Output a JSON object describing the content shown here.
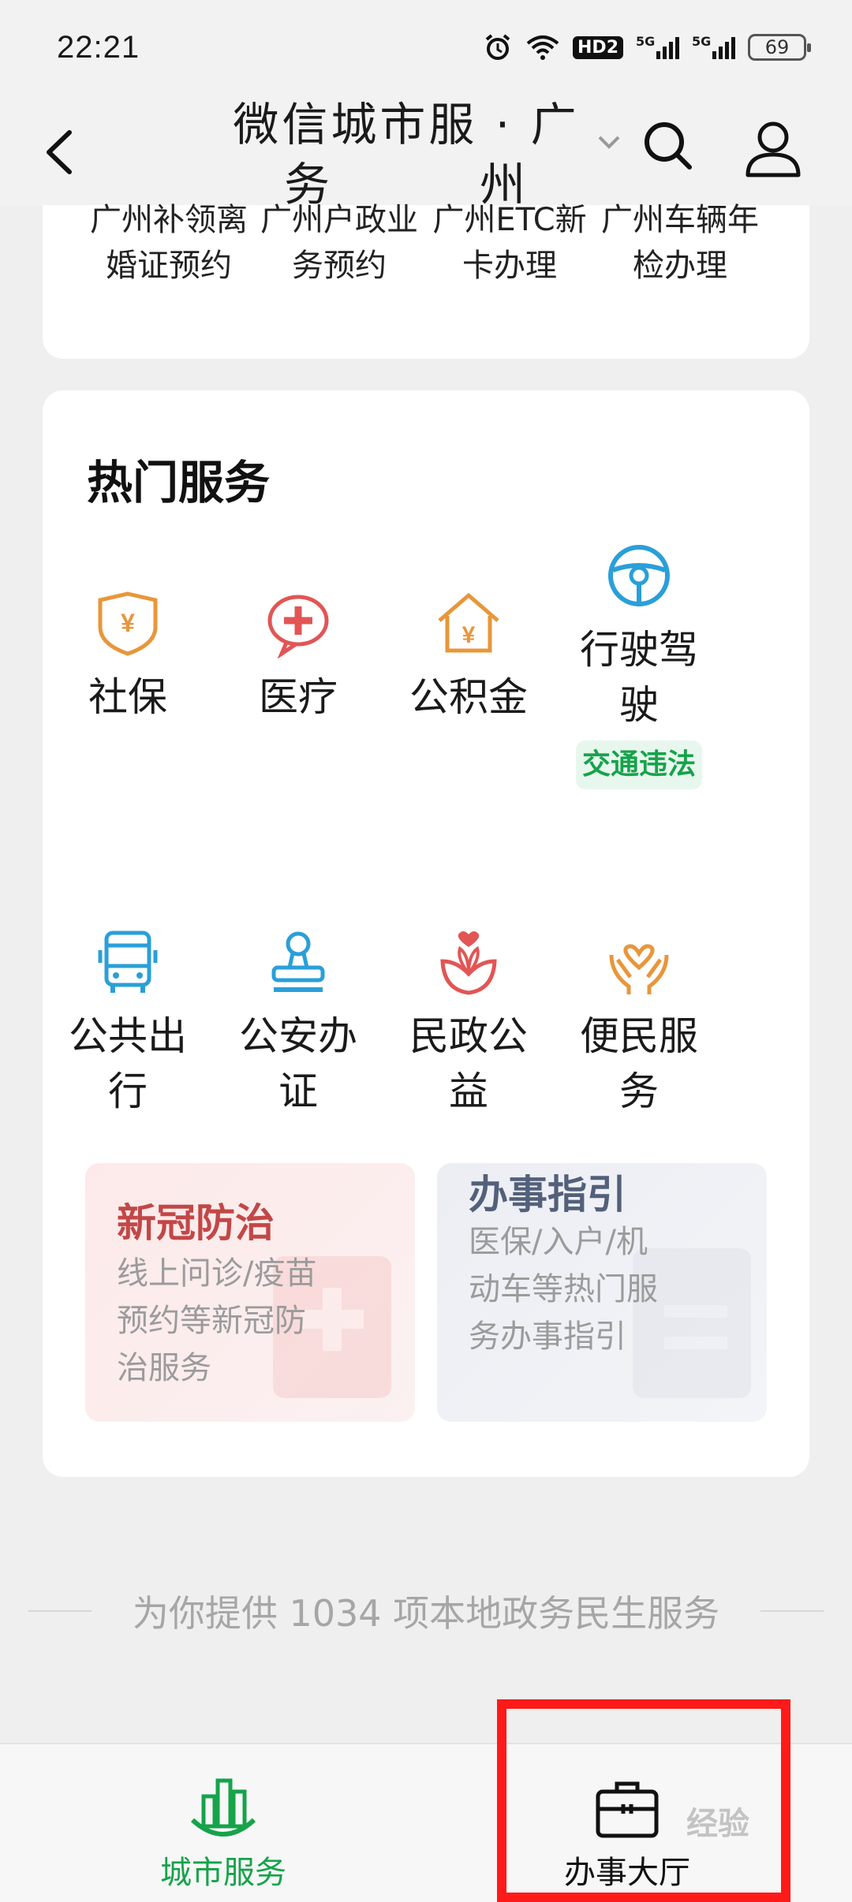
{
  "status_bar": {
    "time": "22:21",
    "hd_label": "HD2",
    "signal1_label": "5G",
    "signal2_label": "5G",
    "battery": "69",
    "icons": [
      "alarm-icon",
      "wifi-icon",
      "signal-icon",
      "battery-icon"
    ]
  },
  "header": {
    "title_line1": "微信城市服 · 广",
    "title_line2": "务　　　州",
    "icons": [
      "back-icon",
      "chevron-down-icon",
      "search-icon",
      "profile-icon"
    ]
  },
  "top_links": [
    {
      "line1": "广州补领离",
      "line2": "婚证预约"
    },
    {
      "line1": "广州户政业",
      "line2": "务预约"
    },
    {
      "line1": "广州ETC新",
      "line2": "卡办理"
    },
    {
      "line1": "广州车辆年",
      "line2": "检办理"
    }
  ],
  "hot_services": {
    "title": "热门服务",
    "items": [
      {
        "label": "社保",
        "icon": "social-insurance-icon",
        "color": "#e8963a"
      },
      {
        "label": "医疗",
        "icon": "medical-icon",
        "color": "#e25555"
      },
      {
        "label": "公积金",
        "icon": "housing-fund-icon",
        "color": "#e8963a"
      },
      {
        "label": "行驶驾驶",
        "icon": "steering-wheel-icon",
        "color": "#2a9fd8",
        "tag": "交通违法"
      },
      {
        "label": "公共出行",
        "icon": "bus-icon",
        "color": "#2a9fd8"
      },
      {
        "label": "公安办证",
        "icon": "stamp-icon",
        "color": "#2a9fd8"
      },
      {
        "label": "民政公益",
        "icon": "flower-heart-icon",
        "color": "#e25555"
      },
      {
        "label": "便民服务",
        "icon": "hands-heart-icon",
        "color": "#e8963a"
      }
    ]
  },
  "promos": {
    "covid": {
      "title": "新冠防治",
      "desc": "线上问诊/疫苗预约等新冠防治服务"
    },
    "guide": {
      "title": "办事指引",
      "desc": "医保/入户/机动车等热门服务办事指引"
    }
  },
  "footer_note": "为你提供 1034 项本地政务民生服务",
  "bottom_nav": {
    "city": {
      "label": "城市服务",
      "icon": "city-buildings-icon",
      "color": "#16a34a"
    },
    "hall": {
      "label": "办事大厅",
      "icon": "briefcase-icon"
    }
  },
  "watermark": "经验"
}
